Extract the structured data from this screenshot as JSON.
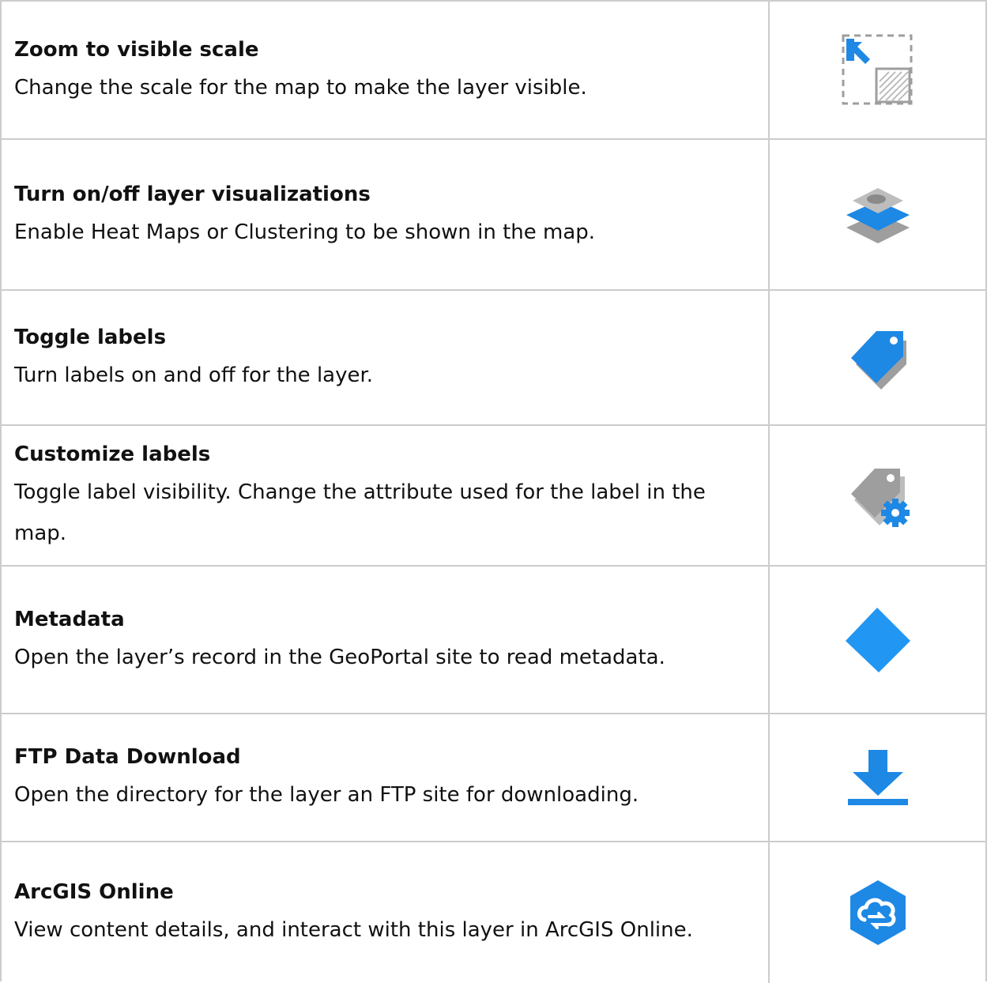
{
  "rows": [
    {
      "title": "Zoom to visible scale",
      "description": "Change the scale for the map to make the layer visible.",
      "icon": "zoom-to-scale-icon"
    },
    {
      "title": "Turn on/off layer visualizations",
      "description": "Enable Heat Maps or Clustering to be shown in the map.",
      "icon": "layer-visualization-icon"
    },
    {
      "title": "Toggle labels",
      "description": "Turn labels on and off for the layer.",
      "icon": "label-tag-icon"
    },
    {
      "title": "Customize labels",
      "description": "Toggle label visibility. Change the attribute used for the label in the map.",
      "icon": "label-settings-icon"
    },
    {
      "title": "Metadata",
      "description": "Open the layer’s record in the GeoPortal site to read metadata.",
      "icon": "metadata-tag-icon"
    },
    {
      "title": "FTP Data Download",
      "description": "Open the directory for the layer an FTP site for downloading.",
      "icon": "download-icon"
    },
    {
      "title": "ArcGIS Online",
      "description": "View content details, and interact with this layer in ArcGIS Online.",
      "icon": "arcgis-online-icon"
    }
  ],
  "colors": {
    "accent": "#1e88e5",
    "border": "#cccccc",
    "gray": "#9e9e9e"
  }
}
